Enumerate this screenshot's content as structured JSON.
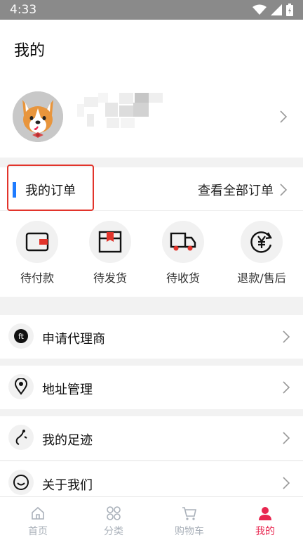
{
  "status_bar": {
    "time": "4:33"
  },
  "header": {
    "title": "我的"
  },
  "orders": {
    "title": "我的订单",
    "view_all": "查看全部订单",
    "items": [
      {
        "label": "待付款",
        "icon": "wallet-icon"
      },
      {
        "label": "待发货",
        "icon": "box-icon"
      },
      {
        "label": "待收货",
        "icon": "truck-icon"
      },
      {
        "label": "退款/售后",
        "icon": "refund-icon"
      }
    ]
  },
  "menu": [
    {
      "label": "申请代理商",
      "icon": "agent-icon"
    },
    {
      "label": "地址管理",
      "icon": "location-icon"
    },
    {
      "label": "我的足迹",
      "icon": "footprint-icon"
    },
    {
      "label": "关于我们",
      "icon": "smile-icon"
    }
  ],
  "tabbar": [
    {
      "label": "首页",
      "icon": "home-icon"
    },
    {
      "label": "分类",
      "icon": "category-icon"
    },
    {
      "label": "购物车",
      "icon": "cart-icon"
    },
    {
      "label": "我的",
      "icon": "person-icon",
      "active": true
    }
  ],
  "colors": {
    "accent": "#e8264f",
    "order_bar": "#1e7bff",
    "highlight_border": "#e2342b"
  }
}
